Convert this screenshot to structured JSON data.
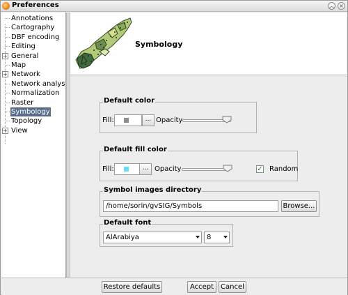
{
  "window": {
    "title": "Preferences",
    "icons": {
      "app": "gvsig-app-icon",
      "minimize": "roll-up-icon",
      "close": "close-icon"
    }
  },
  "tree": {
    "items": [
      {
        "label": "Annotations",
        "expandable": false
      },
      {
        "label": "Cartography",
        "expandable": false
      },
      {
        "label": "DBF encoding",
        "expandable": false
      },
      {
        "label": "Editing",
        "expandable": false
      },
      {
        "label": "General",
        "expandable": true
      },
      {
        "label": "Map",
        "expandable": false
      },
      {
        "label": "Network",
        "expandable": true
      },
      {
        "label": "Network analysis",
        "expandable": false
      },
      {
        "label": "Normalization",
        "expandable": false
      },
      {
        "label": "Raster",
        "expandable": false
      },
      {
        "label": "Symbology",
        "expandable": false,
        "selected": true
      },
      {
        "label": "Topology",
        "expandable": false
      },
      {
        "label": "View",
        "expandable": true
      }
    ]
  },
  "page": {
    "title": "Symbology",
    "header_image": "map-region-icon"
  },
  "default_color": {
    "legend": "Default color",
    "fill_label": "Fill:",
    "fill_color": "#8c8c8c",
    "browse_label": "...",
    "opacity_label": "Opacity",
    "opacity_value_fraction": 1.0
  },
  "default_fill_color": {
    "legend": "Default fill color",
    "fill_label": "Fill:",
    "fill_color": "#66e0f0",
    "browse_label": "...",
    "opacity_label": "Opacity",
    "opacity_value_fraction": 1.0,
    "random_label": "Random",
    "random_checked": true
  },
  "symbol_images": {
    "legend": "Symbol images directory",
    "path_value": "/home/sorin/gvSIG/Symbols",
    "browse_label": "Browse..."
  },
  "default_font": {
    "legend": "Default font",
    "font_value": "AlArabiya",
    "size_value": "8"
  },
  "footer": {
    "restore_label": "Restore defaults",
    "accept_label": "Accept",
    "cancel_label": "Cancel"
  }
}
